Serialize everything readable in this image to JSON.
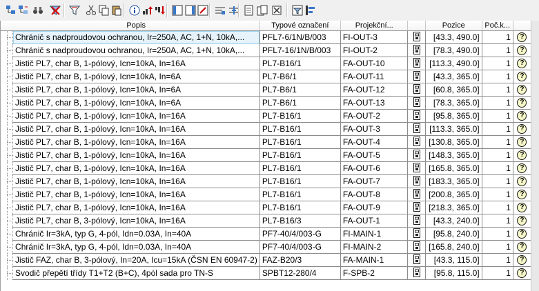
{
  "toolbar": {
    "buttons": [
      "tree-expand-icon",
      "tree-collapse-icon",
      "binoculars-icon",
      "clear-filter-icon",
      "filter-icon",
      "cut-icon",
      "copy-icon",
      "paste-icon",
      "info-icon",
      "sort-up-icon",
      "sort-down-icon",
      "columns-left-icon",
      "columns-right-icon",
      "columns-edit-icon",
      "line-props-icon",
      "line-insert-icon",
      "page-icon",
      "copy-pages-icon",
      "delete-x-icon",
      "filter-list-icon",
      "layout-icon"
    ]
  },
  "columns": [
    "Popis",
    "Typové označení",
    "Projekční...",
    "",
    "Pozice",
    "Poč.k...",
    ""
  ],
  "rows": [
    {
      "popis": "Chránič s nadproudovou ochranou, Ir=250A, AC, 1+N, 10kA,...",
      "typ": "PFL7-6/1N/B/003",
      "proj": "FI-OUT-3",
      "pozice": "[43.3, 490.0]",
      "pocet": "1"
    },
    {
      "popis": "Chránič s nadproudovou ochranou, Ir=250A, AC, 1+N, 10kA,...",
      "typ": "PFL7-16/1N/B/003",
      "proj": "FI-OUT-2",
      "pozice": "[78.3, 490.0]",
      "pocet": "1"
    },
    {
      "popis": "Jistič PL7, char B, 1-pólový, Icn=10kA, In=16A",
      "typ": "PL7-B16/1",
      "proj": "FA-OUT-10",
      "pozice": "[113.3, 490.0]",
      "pocet": "1"
    },
    {
      "popis": "Jistič PL7, char B, 1-pólový, Icn=10kA, In=6A",
      "typ": "PL7-B6/1",
      "proj": "FA-OUT-11",
      "pozice": "[43.3, 365.0]",
      "pocet": "1"
    },
    {
      "popis": "Jistič PL7, char B, 1-pólový, Icn=10kA, In=6A",
      "typ": "PL7-B6/1",
      "proj": "FA-OUT-12",
      "pozice": "[60.8, 365.0]",
      "pocet": "1"
    },
    {
      "popis": "Jistič PL7, char B, 1-pólový, Icn=10kA, In=6A",
      "typ": "PL7-B6/1",
      "proj": "FA-OUT-13",
      "pozice": "[78.3, 365.0]",
      "pocet": "1"
    },
    {
      "popis": "Jistič PL7, char B, 1-pólový, Icn=10kA, In=16A",
      "typ": "PL7-B16/1",
      "proj": "FA-OUT-2",
      "pozice": "[95.8, 365.0]",
      "pocet": "1"
    },
    {
      "popis": "Jistič PL7, char B, 1-pólový, Icn=10kA, In=16A",
      "typ": "PL7-B16/1",
      "proj": "FA-OUT-3",
      "pozice": "[113.3, 365.0]",
      "pocet": "1"
    },
    {
      "popis": "Jistič PL7, char B, 1-pólový, Icn=10kA, In=16A",
      "typ": "PL7-B16/1",
      "proj": "FA-OUT-4",
      "pozice": "[130.8, 365.0]",
      "pocet": "1"
    },
    {
      "popis": "Jistič PL7, char B, 1-pólový, Icn=10kA, In=16A",
      "typ": "PL7-B16/1",
      "proj": "FA-OUT-5",
      "pozice": "[148.3, 365.0]",
      "pocet": "1"
    },
    {
      "popis": "Jistič PL7, char B, 1-pólový, Icn=10kA, In=16A",
      "typ": "PL7-B16/1",
      "proj": "FA-OUT-6",
      "pozice": "[165.8, 365.0]",
      "pocet": "1"
    },
    {
      "popis": "Jistič PL7, char B, 1-pólový, Icn=10kA, In=16A",
      "typ": "PL7-B16/1",
      "proj": "FA-OUT-7",
      "pozice": "[183.3, 365.0]",
      "pocet": "1"
    },
    {
      "popis": "Jistič PL7, char B, 1-pólový, Icn=10kA, In=16A",
      "typ": "PL7-B16/1",
      "proj": "FA-OUT-8",
      "pozice": "[200.8, 365.0]",
      "pocet": "1"
    },
    {
      "popis": "Jistič PL7, char B, 1-pólový, Icn=10kA, In=16A",
      "typ": "PL7-B16/1",
      "proj": "FA-OUT-9",
      "pozice": "[218.3, 365.0]",
      "pocet": "1"
    },
    {
      "popis": "Jistič PL7, char B, 3-pólový, Icn=10kA, In=16A",
      "typ": "PL7-B16/3",
      "proj": "FA-OUT-1",
      "pozice": "[43.3, 240.0]",
      "pocet": "1"
    },
    {
      "popis": "Chránič Ir=3kA, typ G, 4-pól, Idn=0.03A, In=40A",
      "typ": "PF7-40/4/003-G",
      "proj": "FI-MAIN-1",
      "pozice": "[95.8, 240.0]",
      "pocet": "1"
    },
    {
      "popis": "Chránič Ir=3kA, typ G, 4-pól, Idn=0.03A, In=40A",
      "typ": "PF7-40/4/003-G",
      "proj": "FI-MAIN-2",
      "pozice": "[165.8, 240.0]",
      "pocet": "1"
    },
    {
      "popis": "Jistič FAZ, char B, 3-pólový, In=20A, Icu=15kA (ČSN EN 60947-2)",
      "typ": "FAZ-B20/3",
      "proj": "FA-MAIN-1",
      "pozice": "[43.3, 115.0]",
      "pocet": "1"
    },
    {
      "popis": "Svodič přepětí třídy T1+T2 (B+C), 4pól sada pro TN-S",
      "typ": "SPBT12-280/4",
      "proj": "F-SPB-2",
      "pozice": "[95.8, 115.0]",
      "pocet": "1"
    }
  ],
  "help_glyph": "?"
}
